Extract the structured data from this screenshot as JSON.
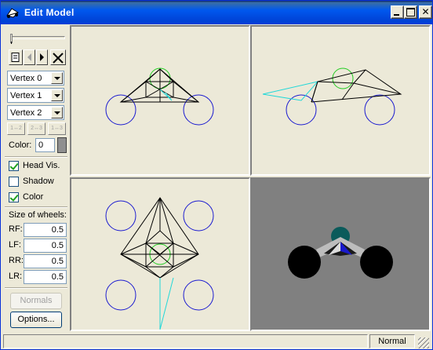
{
  "window": {
    "title": "Edit Model"
  },
  "toolbar": {
    "new_icon": "new-file-icon",
    "prev_icon": "arrow-left-icon",
    "next_icon": "arrow-right-icon",
    "delete_icon": "close-x-icon"
  },
  "vertex_selects": [
    {
      "value": "Vertex 0"
    },
    {
      "value": "Vertex 1"
    },
    {
      "value": "Vertex 2"
    }
  ],
  "swap_buttons": [
    "1↔2",
    "2↔3",
    "1↔3"
  ],
  "color": {
    "label": "Color:",
    "value": "0",
    "swatch": "#8f8f8f"
  },
  "checkboxes": [
    {
      "label": "Head Vis.",
      "checked": true
    },
    {
      "label": "Shadow",
      "checked": false
    },
    {
      "label": "Color",
      "checked": true
    }
  ],
  "wheels": {
    "title": "Size of wheels:",
    "items": [
      {
        "label": "RF:",
        "value": "0.5"
      },
      {
        "label": "LF:",
        "value": "0.5"
      },
      {
        "label": "RR:",
        "value": "0.5"
      },
      {
        "label": "LR:",
        "value": "0.5"
      }
    ]
  },
  "buttons": {
    "normals": "Normals",
    "options": "Options..."
  },
  "status": {
    "left": "",
    "mode": "Normal"
  },
  "colors": {
    "wheel_outline": "#1c1cd0",
    "head_outline": "#22cc22",
    "cyan_line": "#22d8d8",
    "render_bg": "#808080"
  }
}
